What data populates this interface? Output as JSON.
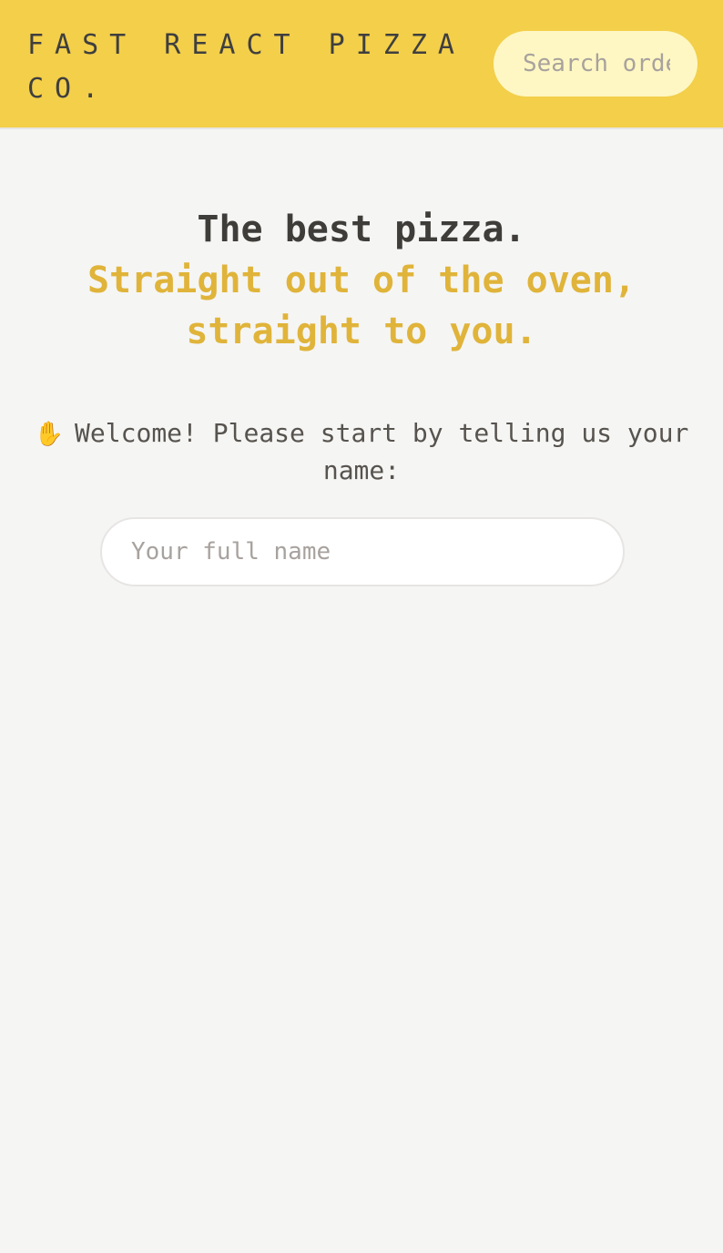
{
  "header": {
    "logo": "FAST REACT PIZZA CO.",
    "search": {
      "placeholder": "Search order #"
    }
  },
  "hero": {
    "title": "The best pizza.",
    "subtitle": "Straight out of the oven, straight to you."
  },
  "welcome": {
    "icon": "waving-hand-icon",
    "text": "Welcome! Please start by telling us your name:"
  },
  "name_input": {
    "placeholder": "Your full name",
    "value": ""
  },
  "colors": {
    "header_background": "#f3cf4a",
    "page_background": "#f5f5f4",
    "accent": "#e0b43a",
    "text": "#44403c"
  }
}
